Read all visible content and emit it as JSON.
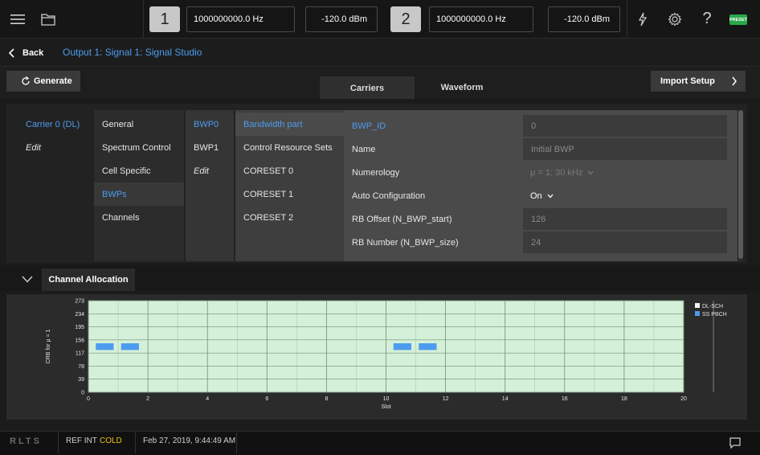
{
  "topbar": {
    "menu_icon": "hamburger-icon",
    "file_icon": "folder-icon",
    "channel1": {
      "number": "1",
      "frequency": "1000000000.0 Hz",
      "power": "-120.0 dBm"
    },
    "channel2": {
      "number": "2",
      "frequency": "1000000000.0 Hz",
      "power": "-120.0 dBm"
    },
    "trigger_icon": "lightning-icon",
    "settings_icon": "gear-icon",
    "help_label": "?",
    "preset_label": "PRESET"
  },
  "breadcrumb": {
    "back_label": "Back",
    "path": "Output 1: Signal 1: Signal Studio"
  },
  "toolbar": {
    "generate_label": "Generate",
    "tabs": [
      "Carriers",
      "Waveform"
    ],
    "active_tab": "Carriers",
    "import_label": "Import Setup"
  },
  "config": {
    "carriers": [
      "Carrier 0 (DL)",
      "Edit"
    ],
    "categories": [
      "General",
      "Spectrum Control",
      "Cell Specific",
      "BWPs",
      "Channels"
    ],
    "bwps": [
      "BWP0",
      "BWP1",
      "Edit"
    ],
    "bwp_sections": [
      "Bandwidth part",
      "Control Resource Sets",
      "CORESET 0",
      "CORESET 1",
      "CORESET 2"
    ],
    "params": [
      {
        "label": "BWP_ID",
        "value": "0"
      },
      {
        "label": "Name",
        "value": "Initial BWP"
      },
      {
        "label": "Numerology",
        "value": "μ = 1: 30 kHz"
      },
      {
        "label": "Auto Configuration",
        "value": "On"
      },
      {
        "label": "RB Offset (N_BWP_start)",
        "value": "126"
      },
      {
        "label": "RB Number (N_BWP_size)",
        "value": "24"
      }
    ]
  },
  "allocation": {
    "title": "Channel Allocation"
  },
  "chart_data": {
    "type": "bar",
    "title": "",
    "xlabel": "Slot",
    "ylabel": "CRB for μ = 1",
    "xlim": [
      0,
      20
    ],
    "ylim": [
      0,
      273
    ],
    "x_ticks": [
      0,
      2,
      4,
      6,
      8,
      10,
      12,
      14,
      16,
      18,
      20
    ],
    "y_ticks": [
      0,
      39,
      78,
      117,
      156,
      195,
      234,
      273
    ],
    "grid": true,
    "legend_position": "top-right",
    "series": [
      {
        "name": "DL-SCH",
        "color": "#f2f2f2",
        "blocks": []
      },
      {
        "name": "SS PBCH",
        "color": "#4d9cf0",
        "blocks": [
          {
            "x_start": 0.25,
            "x_end": 0.85,
            "y_start": 126,
            "y_end": 146
          },
          {
            "x_start": 1.1,
            "x_end": 1.7,
            "y_start": 126,
            "y_end": 146
          },
          {
            "x_start": 10.25,
            "x_end": 10.85,
            "y_start": 126,
            "y_end": 146
          },
          {
            "x_start": 11.1,
            "x_end": 11.7,
            "y_start": 126,
            "y_end": 146
          }
        ]
      }
    ],
    "plot_background": "#d4f0d8"
  },
  "status": {
    "logo": "RLTS",
    "ref": "REF INT",
    "temp": "COLD",
    "datetime": "Feb 27, 2019, 9:44:49 AM",
    "message_icon": "message-icon"
  }
}
